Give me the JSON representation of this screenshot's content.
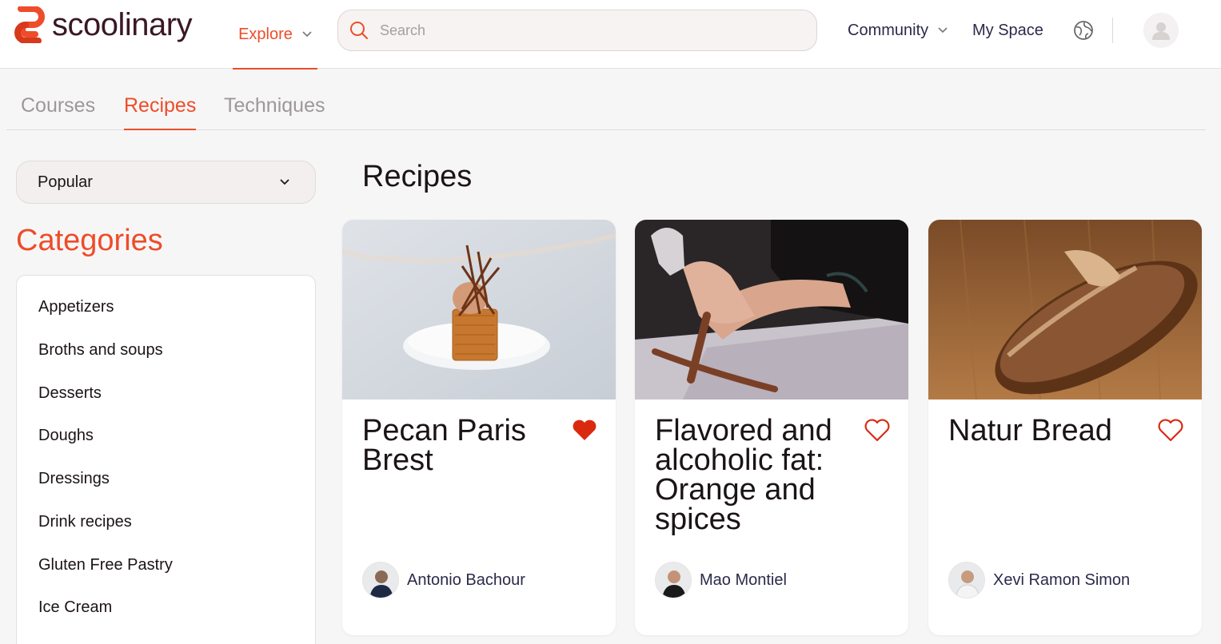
{
  "brand": {
    "name": "scoolinary",
    "accent_color": "#ee4c2a"
  },
  "header": {
    "explore_label": "Explore",
    "search": {
      "placeholder": "Search",
      "value": ""
    },
    "community_label": "Community",
    "myspace_label": "My Space",
    "icons": [
      "search-icon",
      "globe-icon",
      "user-avatar-icon",
      "chevron-down-icon"
    ]
  },
  "tabs": [
    {
      "label": "Courses",
      "active": false
    },
    {
      "label": "Recipes",
      "active": true
    },
    {
      "label": "Techniques",
      "active": false
    }
  ],
  "sidebar": {
    "sort": {
      "selected": "Popular"
    },
    "categories_title": "Categories",
    "categories": [
      "Appetizers",
      "Broths and soups",
      "Desserts",
      "Doughs",
      "Dressings",
      "Drink recipes",
      "Gluten Free Pastry",
      "Ice Cream"
    ]
  },
  "main": {
    "title": "Recipes",
    "cards": [
      {
        "title": "Pecan Paris Brest",
        "author": "Antonio Bachour",
        "favorited": true
      },
      {
        "title": "Flavored and alcoholic fat: Orange and spices",
        "author": "Mao Montiel",
        "favorited": false
      },
      {
        "title": "Natur Bread",
        "author": "Xevi Ramon Simon",
        "favorited": false
      }
    ]
  }
}
